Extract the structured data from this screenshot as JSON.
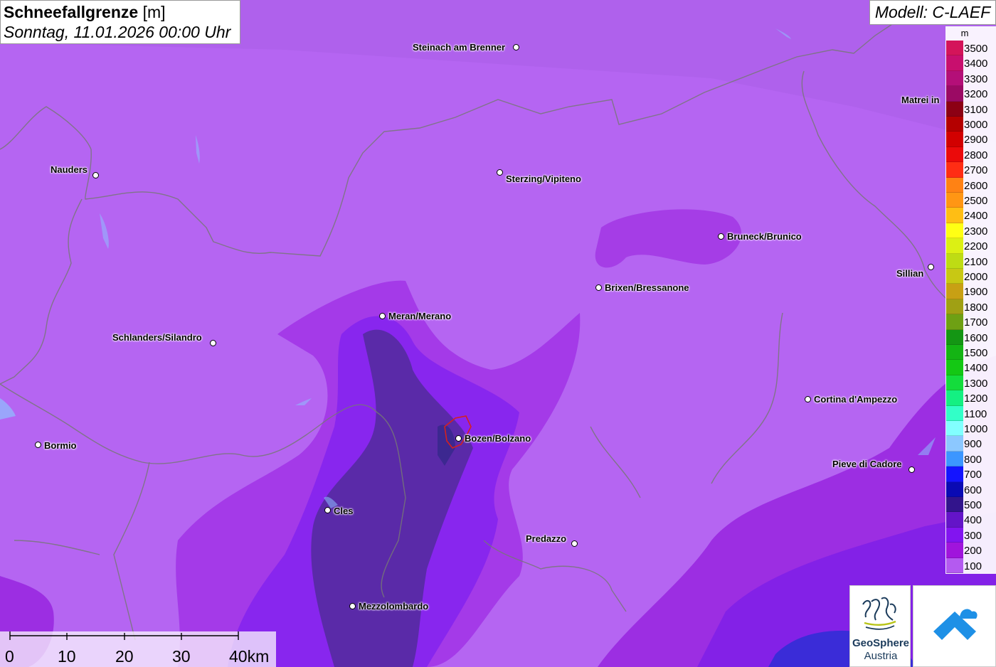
{
  "header": {
    "title_bold": "Schneefallgrenze",
    "title_unit": "[m]",
    "subtitle": "Sonntag, 11.01.2026 00:00 Uhr"
  },
  "model": {
    "label": "Modell: C-LAEF"
  },
  "legend": {
    "unit": "m",
    "entries": [
      {
        "value": "3500",
        "color": "#d4145a"
      },
      {
        "value": "3400",
        "color": "#c80f6e"
      },
      {
        "value": "3300",
        "color": "#b40f78"
      },
      {
        "value": "3200",
        "color": "#9b0a64"
      },
      {
        "value": "3100",
        "color": "#8c0014"
      },
      {
        "value": "3000",
        "color": "#b40000"
      },
      {
        "value": "2900",
        "color": "#d20000"
      },
      {
        "value": "2800",
        "color": "#eb0a0a"
      },
      {
        "value": "2700",
        "color": "#ff2d14"
      },
      {
        "value": "2600",
        "color": "#ff8214"
      },
      {
        "value": "2500",
        "color": "#ff9614"
      },
      {
        "value": "2400",
        "color": "#ffbe14"
      },
      {
        "value": "2300",
        "color": "#ffff14"
      },
      {
        "value": "2200",
        "color": "#dcf014"
      },
      {
        "value": "2100",
        "color": "#bedc14"
      },
      {
        "value": "2000",
        "color": "#c8c814"
      },
      {
        "value": "1900",
        "color": "#c8a014"
      },
      {
        "value": "1800",
        "color": "#a0a014"
      },
      {
        "value": "1700",
        "color": "#6ea014"
      },
      {
        "value": "1600",
        "color": "#149614"
      },
      {
        "value": "1500",
        "color": "#14b414"
      },
      {
        "value": "1400",
        "color": "#14c814"
      },
      {
        "value": "1300",
        "color": "#14dc3c"
      },
      {
        "value": "1200",
        "color": "#14f082"
      },
      {
        "value": "1100",
        "color": "#32ffc8"
      },
      {
        "value": "1000",
        "color": "#82ffff"
      },
      {
        "value": "900",
        "color": "#8cc8ff"
      },
      {
        "value": "800",
        "color": "#3c96ff"
      },
      {
        "value": "700",
        "color": "#1414ff"
      },
      {
        "value": "600",
        "color": "#0a0ab4"
      },
      {
        "value": "500",
        "color": "#32148c"
      },
      {
        "value": "400",
        "color": "#6414c8"
      },
      {
        "value": "300",
        "color": "#8214f0"
      },
      {
        "value": "200",
        "color": "#a014dc"
      },
      {
        "value": "100",
        "color": "#b45af0"
      }
    ]
  },
  "cities": [
    {
      "name": "Steinach am Brenner"
    },
    {
      "name": "Matrei in"
    },
    {
      "name": "Nauders"
    },
    {
      "name": "Sterzing/Vipiteno"
    },
    {
      "name": "Bruneck/Brunico"
    },
    {
      "name": "Sillian"
    },
    {
      "name": "Brixen/Bressanone"
    },
    {
      "name": "Meran/Merano"
    },
    {
      "name": "Schlanders/Silandro"
    },
    {
      "name": "Cortina d'Ampezzo"
    },
    {
      "name": "Bormio"
    },
    {
      "name": "Bozen/Bolzano"
    },
    {
      "name": "Pieve di Cadore"
    },
    {
      "name": "Cles"
    },
    {
      "name": "Predazzo"
    },
    {
      "name": "Mezzolombardo"
    }
  ],
  "scalebar": {
    "labels": [
      "0",
      "10",
      "20",
      "30",
      "40km"
    ]
  },
  "logos": {
    "geosphere_line1": "GeoSphere",
    "geosphere_line2": "Austria"
  }
}
